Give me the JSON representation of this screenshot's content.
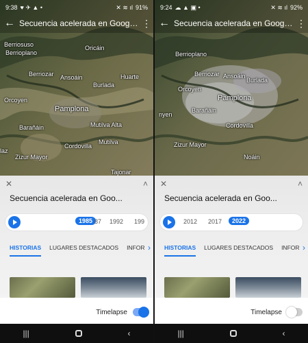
{
  "screens": [
    {
      "status": {
        "time": "9:38",
        "left_icons": "♥ ✈ ▲ •",
        "right_icons": "✕ ≋ ıl",
        "battery": "91%"
      },
      "appbar": {
        "title": "Secuencia acelerada en Google..."
      },
      "places": {
        "berriosuso": "Berriosuso",
        "berrioplano": "Berrioplano",
        "oricain": "Oricáin",
        "berriozar": "Berriozar",
        "ansoain": "Ansoáin",
        "huarte": "Huarte",
        "burlada": "Burlada",
        "orcoyen": "Orcoyen",
        "pamplona": "Pamplona",
        "barañain": "Barañáin",
        "mutilva_alta": "Mutilva Alta",
        "mutilva": "Mutilva",
        "cordovilla": "Cordovilla",
        "galar": "laz",
        "zizur": "Zizur Mayor",
        "tajonar": "Tajonar"
      },
      "panel": {
        "title": "Secuencia acelerada en Goo...",
        "years": [
          "1985",
          "87",
          "1992",
          "199"
        ],
        "selected_year": "1985",
        "tabs": [
          "HISTORIAS",
          "LUGARES DESTACADOS",
          "INFOR"
        ],
        "timelapse_label": "Timelapse",
        "timelapse_on": true
      }
    },
    {
      "status": {
        "time": "9:24",
        "left_icons": "☁ ▲ ▣ •",
        "right_icons": "✕ ≋ ıl",
        "battery": "92%"
      },
      "appbar": {
        "title": "Secuencia acelerada en Google..."
      },
      "places": {
        "berrioplano": "Berrioplano",
        "berriozar": "Berriozar",
        "ansoain": "Ansoáin",
        "burlada": "Burlada",
        "orcoyen": "Orcoyen",
        "pamplona": "Pamplona",
        "barañain": "Barañáin",
        "cordovilla": "Cordovilla",
        "noain": "Noáin",
        "zizur": "Zizur Mayor",
        "hoyen": "nyen"
      },
      "panel": {
        "title": "Secuencia acelerada en Goo...",
        "years": [
          "2012",
          "2017",
          "2022"
        ],
        "selected_year": "2022",
        "tabs": [
          "HISTORIAS",
          "LUGARES DESTACADOS",
          "INFOR"
        ],
        "timelapse_label": "Timelapse",
        "timelapse_on": false
      }
    }
  ],
  "colors": {
    "accent": "#1a73e8",
    "panel_bg": "#ececec"
  },
  "icons": {
    "back": "arrow-left-icon",
    "menu": "more-vert-icon",
    "close": "close-icon",
    "collapse": "chevron-up-icon",
    "play": "play-icon",
    "tab_next": "chevron-right-icon"
  }
}
